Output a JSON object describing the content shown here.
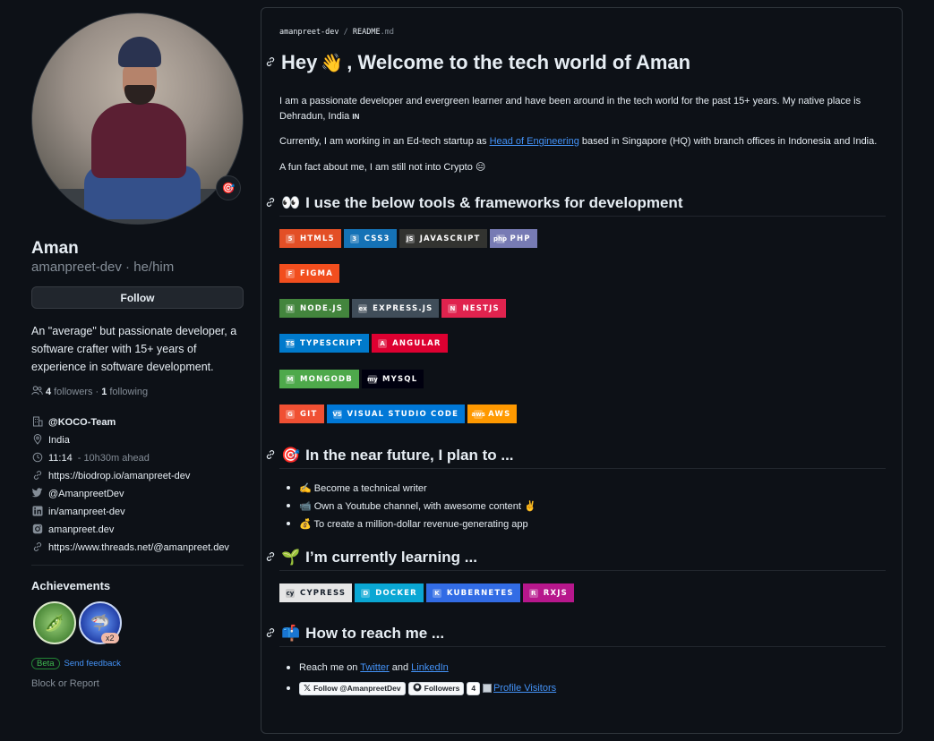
{
  "profile": {
    "name": "Aman",
    "handle": "amanpreet-dev · he/him",
    "status_emoji": "🎯",
    "follow_label": "Follow",
    "bio": "An \"average\" but passionate developer, a software crafter with 15+ years of experience in software development.",
    "followers_count": "4",
    "followers_label": "followers",
    "separator": "·",
    "following_count": "1",
    "following_label": "following",
    "org": "@KOCO-Team",
    "location": "India",
    "time": "11:14",
    "time_note": "- 10h30m ahead",
    "website": "https://biodrop.io/amanpreet-dev",
    "twitter": "@AmanpreetDev",
    "linkedin": "in/amanpreet-dev",
    "instagram": "amanpreet.dev",
    "threads": "https://www.threads.net/@amanpreet.dev"
  },
  "achievements": {
    "title": "Achievements",
    "badge1_emoji": "🫛",
    "badge2_emoji": "🦈",
    "badge2_count": "x2",
    "beta_label": "Beta",
    "feedback_label": "Send feedback",
    "report_label": "Block or Report"
  },
  "readme": {
    "path_user": "amanpreet-dev",
    "path_sep": "/",
    "path_file": "README",
    "path_ext": ".md",
    "h1_prefix": "Hey",
    "h1_emoji": "👋",
    "h1_suffix": ", Welcome to the tech world of Aman",
    "intro_1": "I am a passionate developer and evergreen learner and have been around in the tech world for the past 15+ years. My native place is Dehradun, India ",
    "intro_1_flag": "IN",
    "intro_2_pre": "Currently, I am working in an Ed-tech startup as ",
    "intro_2_link": "Head of Engineering",
    "intro_2_post": " based in Singapore (HQ) with branch offices in Indonesia and India.",
    "intro_3": "A fun fact about me, I am still not into Crypto 😑",
    "tools_emoji": "👀",
    "tools_title": "I use the below tools & frameworks for development",
    "tools_rows": [
      [
        {
          "label": "HTML5",
          "icon": "5",
          "color": "#e34f26"
        },
        {
          "label": "CSS3",
          "icon": "3",
          "color": "#1572b6"
        },
        {
          "label": "JAVASCRIPT",
          "icon": "JS",
          "color": "#323330"
        },
        {
          "label": "PHP",
          "icon": "php",
          "color": "#777bb4"
        }
      ],
      [
        {
          "label": "FIGMA",
          "icon": "F",
          "color": "#f24e1e"
        }
      ],
      [
        {
          "label": "NODE.JS",
          "icon": "N",
          "color": "#43853d"
        },
        {
          "label": "EXPRESS.JS",
          "icon": "ex",
          "color": "#404d59"
        },
        {
          "label": "NESTJS",
          "icon": "N",
          "color": "#e0234e"
        }
      ],
      [
        {
          "label": "TYPESCRIPT",
          "icon": "TS",
          "color": "#007acc"
        },
        {
          "label": "ANGULAR",
          "icon": "A",
          "color": "#dd0031"
        }
      ],
      [
        {
          "label": "MONGODB",
          "icon": "M",
          "color": "#4ea94b"
        },
        {
          "label": "MYSQL",
          "icon": "my",
          "color": "#00000f"
        }
      ],
      [
        {
          "label": "GIT",
          "icon": "G",
          "color": "#f05033"
        },
        {
          "label": "VISUAL STUDIO CODE",
          "icon": "VS",
          "color": "#0078d7"
        },
        {
          "label": "AWS",
          "icon": "aws",
          "color": "#ff9900"
        }
      ]
    ],
    "future_emoji": "🎯",
    "future_title": "In the near future, I plan to ...",
    "future_items": [
      "✍️ Become a technical writer",
      "📹 Own a Youtube channel, with awesome content ✌️",
      "💰 To create a million-dollar revenue-generating app"
    ],
    "learning_emoji": "🌱",
    "learning_title": "I’m currently learning ...",
    "learning_badges": [
      {
        "label": "CYPRESS",
        "icon": "cy",
        "color": "#e6e6e6",
        "text_color": "#17202c"
      },
      {
        "label": "DOCKER",
        "icon": "D",
        "color": "#0aa7d4",
        "text_color": "#ffffff"
      },
      {
        "label": "KUBERNETES",
        "icon": "K",
        "color": "#326ce5",
        "text_color": "#ffffff"
      },
      {
        "label": "RXJS",
        "icon": "R",
        "color": "#b7178c",
        "text_color": "#ffffff"
      }
    ],
    "reach_emoji": "📫",
    "reach_title": "How to reach me ...",
    "reach_pre": "Reach me on ",
    "reach_twitter": "Twitter",
    "reach_and": " and ",
    "reach_linkedin": "LinkedIn",
    "follow_twitter_label": "Follow @AmanpreetDev",
    "github_followers_label": "Followers",
    "github_followers_count": "4",
    "visitors_alt": "Profile Visitors"
  }
}
